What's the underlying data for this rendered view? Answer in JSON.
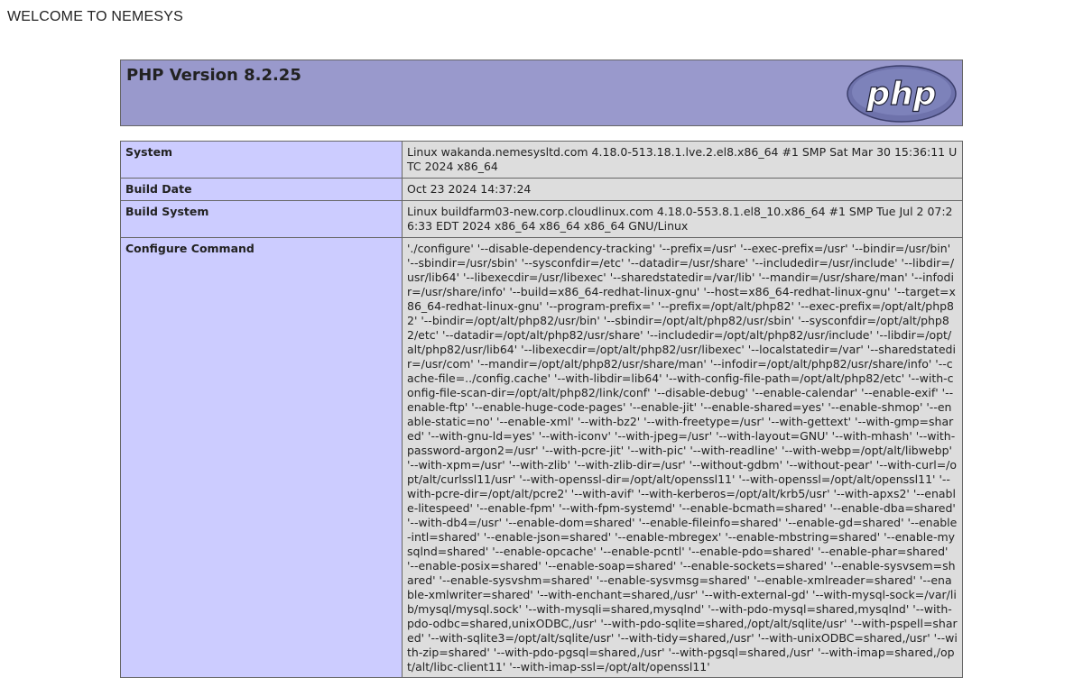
{
  "page": {
    "welcome": "WELCOME TO NEMESYS"
  },
  "header": {
    "title": "PHP Version 8.2.25",
    "logo_icon": "php-logo-icon",
    "logo_text": "php",
    "bg_color": "#9999cc"
  },
  "info": {
    "rows": [
      {
        "label": "System",
        "value": "Linux wakanda.nemesysltd.com 4.18.0-513.18.1.lve.2.el8.x86_64 #1 SMP Sat Mar 30 15:36:11 UTC 2024 x86_64"
      },
      {
        "label": "Build Date",
        "value": "Oct 23 2024 14:37:24"
      },
      {
        "label": "Build System",
        "value": "Linux buildfarm03-new.corp.cloudlinux.com 4.18.0-553.8.1.el8_10.x86_64 #1 SMP Tue Jul 2 07:26:33 EDT 2024 x86_64 x86_64 x86_64 GNU/Linux"
      },
      {
        "label": "Configure Command",
        "value": "'./configure' '--disable-dependency-tracking' '--prefix=/usr' '--exec-prefix=/usr' '--bindir=/usr/bin' '--sbindir=/usr/sbin' '--sysconfdir=/etc' '--datadir=/usr/share' '--includedir=/usr/include' '--libdir=/usr/lib64' '--libexecdir=/usr/libexec' '--sharedstatedir=/var/lib' '--mandir=/usr/share/man' '--infodir=/usr/share/info' '--build=x86_64-redhat-linux-gnu' '--host=x86_64-redhat-linux-gnu' '--target=x86_64-redhat-linux-gnu' '--program-prefix=' '--prefix=/opt/alt/php82' '--exec-prefix=/opt/alt/php82' '--bindir=/opt/alt/php82/usr/bin' '--sbindir=/opt/alt/php82/usr/sbin' '--sysconfdir=/opt/alt/php82/etc' '--datadir=/opt/alt/php82/usr/share' '--includedir=/opt/alt/php82/usr/include' '--libdir=/opt/alt/php82/usr/lib64' '--libexecdir=/opt/alt/php82/usr/libexec' '--localstatedir=/var' '--sharedstatedir=/usr/com' '--mandir=/opt/alt/php82/usr/share/man' '--infodir=/opt/alt/php82/usr/share/info' '--cache-file=../config.cache' '--with-libdir=lib64' '--with-config-file-path=/opt/alt/php82/etc' '--with-config-file-scan-dir=/opt/alt/php82/link/conf' '--disable-debug' '--enable-calendar' '--enable-exif' '--enable-ftp' '--enable-huge-code-pages' '--enable-jit' '--enable-shared=yes' '--enable-shmop' '--enable-static=no' '--enable-xml' '--with-bz2' '--with-freetype=/usr' '--with-gettext' '--with-gmp=shared' '--with-gnu-ld=yes' '--with-iconv' '--with-jpeg=/usr' '--with-layout=GNU' '--with-mhash' '--with-password-argon2=/usr' '--with-pcre-jit' '--with-pic' '--with-readline' '--with-webp=/opt/alt/libwebp' '--with-xpm=/usr' '--with-zlib' '--with-zlib-dir=/usr' '--without-gdbm' '--without-pear' '--with-curl=/opt/alt/curlssl11/usr' '--with-openssl-dir=/opt/alt/openssl11' '--with-openssl=/opt/alt/openssl11' '--with-pcre-dir=/opt/alt/pcre2' '--with-avif' '--with-kerberos=/opt/alt/krb5/usr' '--with-apxs2' '--enable-litespeed' '--enable-fpm' '--with-fpm-systemd' '--enable-bcmath=shared' '--enable-dba=shared' '--with-db4=/usr' '--enable-dom=shared' '--enable-fileinfo=shared' '--enable-gd=shared' '--enable-intl=shared' '--enable-json=shared' '--enable-mbregex' '--enable-mbstring=shared' '--enable-mysqlnd=shared' '--enable-opcache' '--enable-pcntl' '--enable-pdo=shared' '--enable-phar=shared' '--enable-posix=shared' '--enable-soap=shared' '--enable-sockets=shared' '--enable-sysvsem=shared' '--enable-sysvshm=shared' '--enable-sysvmsg=shared' '--enable-xmlreader=shared' '--enable-xmlwriter=shared' '--with-enchant=shared,/usr' '--with-external-gd' '--with-mysql-sock=/var/lib/mysql/mysql.sock' '--with-mysqli=shared,mysqlnd' '--with-pdo-mysql=shared,mysqlnd' '--with-pdo-odbc=shared,unixODBC,/usr' '--with-pdo-sqlite=shared,/opt/alt/sqlite/usr' '--with-pspell=shared' '--with-sqlite3=/opt/alt/sqlite/usr' '--with-tidy=shared,/usr' '--with-unixODBC=shared,/usr' '--with-zip=shared' '--with-pdo-pgsql=shared,/usr' '--with-pgsql=shared,/usr' '--with-imap=shared,/opt/alt/libc-client11' '--with-imap-ssl=/opt/alt/openssl11'"
      }
    ]
  }
}
